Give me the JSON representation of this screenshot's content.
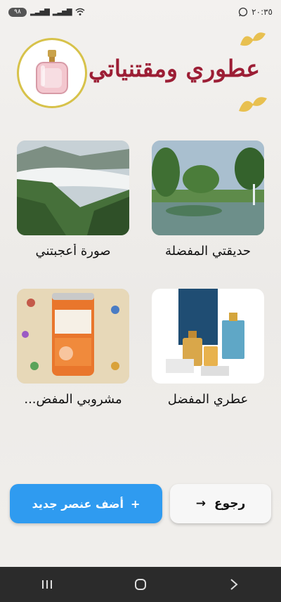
{
  "status_bar": {
    "time": "٢٠:٣٥",
    "battery": "٩٨",
    "whatsapp_icon": "whatsapp-icon"
  },
  "header": {
    "title": "عطوري ومقتنياتي",
    "logo_icon": "perfume-bottle-icon",
    "title_color": "#9c1e35"
  },
  "cards": [
    {
      "label": "حديقتي المفضلة",
      "image": "garden-lake-image"
    },
    {
      "label": "صورة أعجبتني",
      "image": "misty-mountains-image"
    },
    {
      "label": "عطري المفضل",
      "image": "perfume-boxes-image"
    },
    {
      "label": "مشروبي المفض...",
      "image": "mirinda-can-image"
    }
  ],
  "actions": {
    "add_label": "أضف عنصر جديد",
    "add_icon": "+",
    "back_label": "رجوع",
    "back_icon": "→",
    "add_color": "#2f9bf0"
  },
  "nav": [
    "recent-apps-icon",
    "home-icon",
    "back-icon"
  ]
}
